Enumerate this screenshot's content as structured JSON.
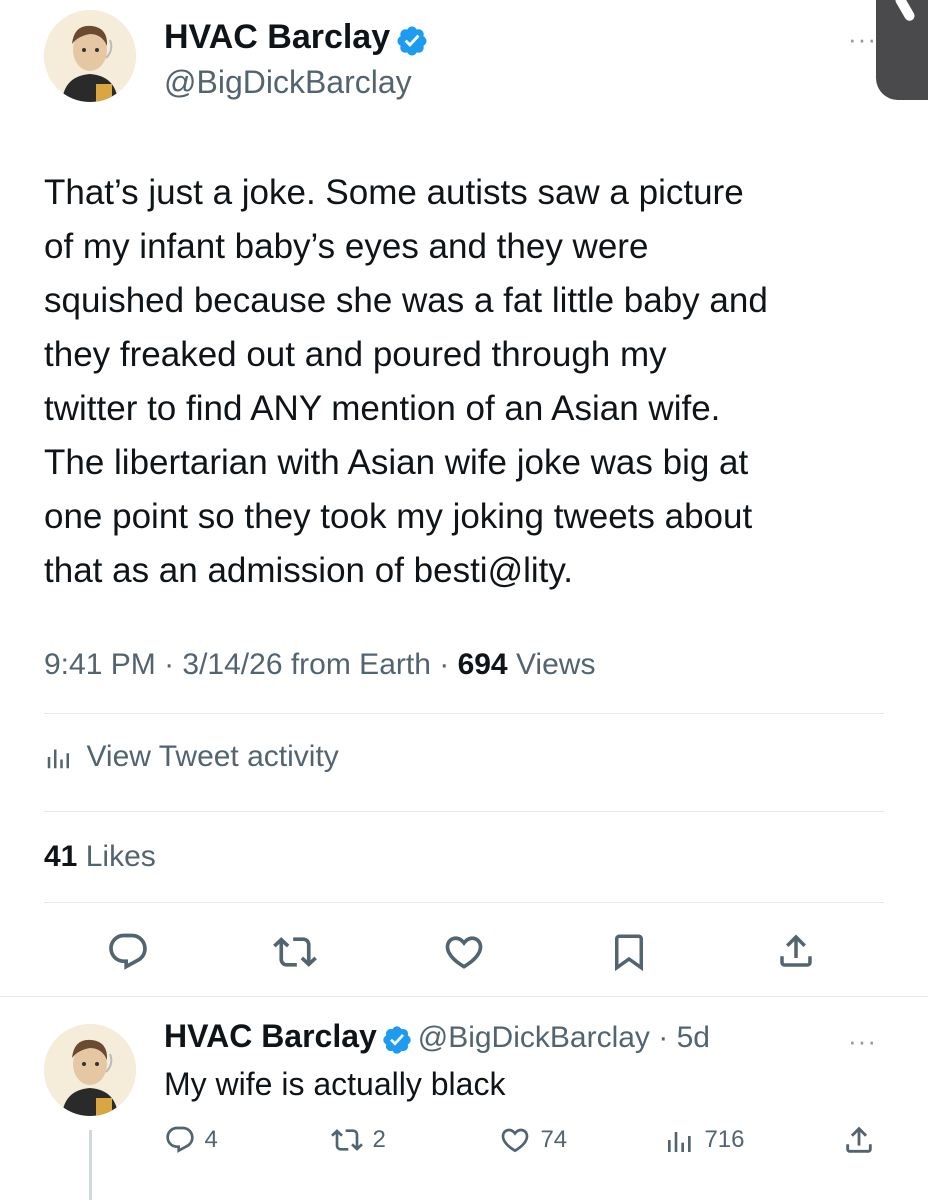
{
  "main_tweet": {
    "author_name": "HVAC Barclay",
    "author_handle": "@BigDickBarclay",
    "text_lines": [
      "That’s just a joke. Some autists saw a picture",
      "of my infant baby’s eyes and they were",
      "squished because she was a fat little baby and",
      "they freaked out and poured through my",
      "twitter to find ANY mention of an Asian wife.",
      "The libertarian with Asian wife joke was big at",
      "one point so they took my joking tweets about",
      "that as an admission of besti@lity."
    ],
    "time": "9:41 PM",
    "date": "3/14/26",
    "source": "from Earth",
    "views_count": "694",
    "views_label": "Views",
    "activity_label": "View Tweet activity",
    "likes_count": "41",
    "likes_label": "Likes"
  },
  "reply_tweet": {
    "author_name": "HVAC Barclay",
    "author_handle": "@BigDickBarclay",
    "age": "5d",
    "text": "My wife is actually black",
    "replies": "4",
    "retweets": "2",
    "likes": "74",
    "views": "716"
  },
  "icons": {
    "verified": "verified-badge-icon",
    "reply": "reply-icon",
    "retweet": "retweet-icon",
    "like": "heart-icon",
    "bookmark": "bookmark-icon",
    "share": "share-icon",
    "analytics": "analytics-icon",
    "more": "more-icon"
  },
  "colors": {
    "verified_blue": "#1d9bf0",
    "text": "#0f1419",
    "secondary": "#536471",
    "divider": "#e6e9ec"
  }
}
